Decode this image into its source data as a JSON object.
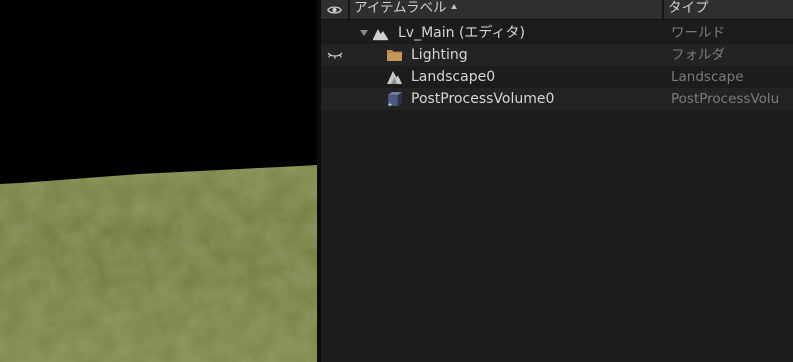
{
  "outliner": {
    "header": {
      "visibility_icon": "eye-icon",
      "item_label_column": "アイテムラベル",
      "type_column": "タイプ",
      "sort_icon": "sort-ascending-icon"
    },
    "rows": [
      {
        "label": "Lv_Main (エディタ)",
        "type": "ワールド",
        "icon": "level-icon",
        "expanded": true,
        "indent": 0,
        "visibility": ""
      },
      {
        "label": "Lighting",
        "type": "フォルダ",
        "icon": "folder-icon",
        "indent": 1,
        "visibility": "hidden-eye-icon"
      },
      {
        "label": "Landscape0",
        "type": "Landscape",
        "icon": "landscape-icon",
        "indent": 1,
        "visibility": ""
      },
      {
        "label": "PostProcessVolume0",
        "type": "PostProcessVolu",
        "icon": "post-process-volume-icon",
        "indent": 1,
        "visibility": ""
      }
    ]
  },
  "colors": {
    "outliner_bg": "#1c1c1c",
    "header_bg": "#2f2f2f",
    "row_alt_bg": "#232323",
    "label_text": "#d6d6d6",
    "type_text": "#7b7b7b",
    "folder": "#b88a4a",
    "grass": "#6d7a3c",
    "sky": "#000000"
  }
}
